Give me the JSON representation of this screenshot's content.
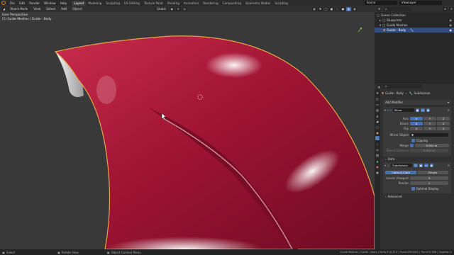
{
  "menubar": {
    "menus": [
      "File",
      "Edit",
      "Render",
      "Window",
      "Help"
    ],
    "workspaces": [
      "Layout",
      "Modeling",
      "Sculpting",
      "UV Editing",
      "Texture Paint",
      "Shading",
      "Animation",
      "Rendering",
      "Compositing",
      "Geometry Nodes",
      "Scripting"
    ],
    "active_workspace": "Layout",
    "scene": "Scene",
    "view_layer": "ViewLayer"
  },
  "viewport_header": {
    "mode": "Object Mode",
    "menus": [
      "View",
      "Select",
      "Add",
      "Object"
    ],
    "transform_orientation": "Global"
  },
  "viewport": {
    "title": "User Perspective",
    "subtitle": "(1) Guide Meshes | Guide - Body"
  },
  "outliner": {
    "rows": [
      {
        "label": "Scene Collection",
        "selected": false,
        "indent": 0
      },
      {
        "label": "Blueprints",
        "selected": false,
        "indent": 1
      },
      {
        "label": "Guide Meshes",
        "selected": false,
        "indent": 1
      },
      {
        "label": "Guide - Body",
        "selected": true,
        "indent": 2
      }
    ]
  },
  "properties": {
    "object_name": "Guide - Body",
    "modifier_tab": "Subdivision",
    "add_modifier": "Add Modifier",
    "mirror": {
      "name": "Mirror",
      "axis_label": "Axis",
      "bisect_label": "Bisect",
      "flip_label": "Flip",
      "axes": [
        "X",
        "Y",
        "Z"
      ],
      "mirror_object_label": "Mirror Object",
      "clipping_label": "Clipping",
      "merge_label": "Merge",
      "merge_value": "0.001 m",
      "bisect_distance_label": "Bisect Distance",
      "bisect_distance_value": "0.001 m",
      "data_label": "Data"
    },
    "subdivision": {
      "name": "Subdivision",
      "catmull_clark": "Catmull-Clark",
      "simple": "Simple",
      "levels_viewport_label": "Levels Viewport",
      "levels_viewport_value": "3",
      "render_label": "Render",
      "render_value": "2",
      "optimal_display_label": "Optimal Display",
      "advanced_label": "Advanced"
    }
  },
  "statusbar": {
    "select": "Select",
    "rotate_view": "Rotate View",
    "context_menu": "Object Context Menu",
    "stats": "Guide Meshes | Guide - Body | Verts:210,512 | Faces:209,654 | Tris:419,308 | Objects:1/"
  },
  "colors": {
    "accent": "#4772b3",
    "object_orange": "#e87d0d",
    "mesh_red": "#b8183a",
    "viewport_bg": "#393939"
  }
}
